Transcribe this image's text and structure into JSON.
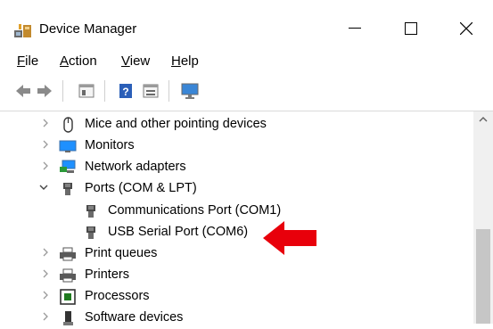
{
  "window": {
    "title": "Device Manager",
    "controls": [
      "minimize",
      "maximize",
      "close"
    ]
  },
  "menu": [
    {
      "label": "File",
      "accel": "F",
      "rest": "ile"
    },
    {
      "label": "Action",
      "accel": "A",
      "rest": "ction"
    },
    {
      "label": "View",
      "accel": "V",
      "rest": "iew"
    },
    {
      "label": "Help",
      "accel": "H",
      "rest": "elp"
    }
  ],
  "toolbar": {
    "icons": [
      "back-arrow-icon",
      "forward-arrow-icon",
      "properties-icon",
      "help-icon",
      "show-hidden-icon",
      "monitor-icon"
    ]
  },
  "tree": {
    "rows": [
      {
        "label": "Mice and other pointing devices",
        "icon": "mouse-icon",
        "expanded": false
      },
      {
        "label": "Monitors",
        "icon": "monitor-icon",
        "expanded": false
      },
      {
        "label": "Network adapters",
        "icon": "network-adapter-icon",
        "expanded": false
      },
      {
        "label": "Ports (COM & LPT)",
        "icon": "port-icon",
        "expanded": true
      },
      {
        "label": "Communications Port (COM1)",
        "icon": "port-icon",
        "child": true
      },
      {
        "label": "USB Serial Port (COM6)",
        "icon": "port-icon",
        "child": true
      },
      {
        "label": "Print queues",
        "icon": "printer-icon",
        "expanded": false
      },
      {
        "label": "Printers",
        "icon": "printer-icon",
        "expanded": false
      },
      {
        "label": "Processors",
        "icon": "processor-icon",
        "expanded": false
      },
      {
        "label": "Software devices",
        "icon": "software-device-icon",
        "expanded": false
      }
    ]
  },
  "colors": {
    "annotation_arrow": "#e8000b",
    "monitor_blue": "#1e90ff",
    "icon_gray": "#555555"
  }
}
